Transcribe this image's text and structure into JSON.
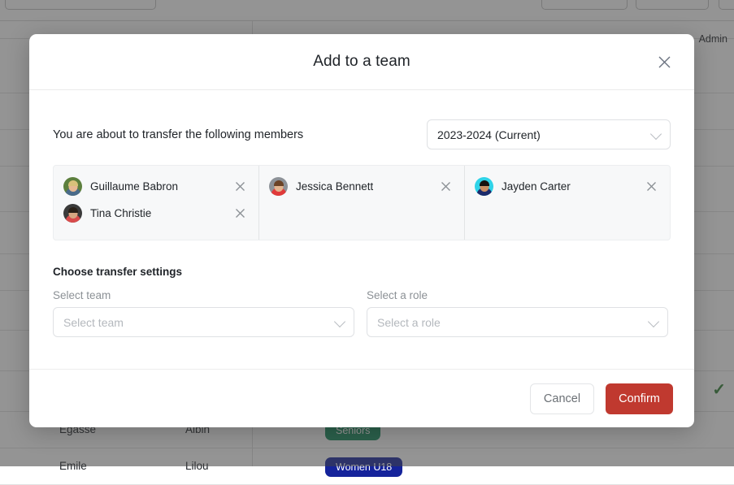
{
  "background": {
    "admin_label": "Admin",
    "check_icon": "check-icon",
    "rows": [
      {
        "last": "Egasse",
        "first": "Albin",
        "badge": "Seniors",
        "badge_color": "#12895a"
      },
      {
        "last": "Emile",
        "first": "Lilou",
        "badge": "Women U18",
        "badge_color": "#15239b"
      }
    ]
  },
  "modal": {
    "title": "Add to a team",
    "close_icon": "close-icon",
    "transfer_label": "You are about to transfer the following members",
    "year_select": {
      "value": "2023-2024 (Current)",
      "chevron_icon": "chevron-down-icon"
    },
    "members": [
      {
        "name": "Guillaume Babron",
        "remove_icon": "close-icon",
        "avatar": {
          "bg": "#5c7f3d",
          "skin": "#e6b892",
          "hair": "#d8c17a",
          "shirt": "#4a6b8a"
        }
      },
      {
        "name": "Tina Christie",
        "remove_icon": "close-icon",
        "avatar": {
          "bg": "#3a3a3a",
          "skin": "#d8a782",
          "hair": "#2b2118",
          "shirt": "#d94b4b"
        }
      },
      {
        "name": "Jessica Bennett",
        "remove_icon": "close-icon",
        "avatar": {
          "bg": "#8d9298",
          "skin": "#e3b48e",
          "hair": "#6b4326",
          "shirt": "#e03a3a"
        }
      },
      {
        "name": "Jayden Carter",
        "remove_icon": "close-icon",
        "avatar": {
          "bg": "#2fd3e8",
          "skin": "#c98f63",
          "hair": "#14120f",
          "shirt": "#1b2a6b"
        }
      }
    ],
    "settings": {
      "heading": "Choose transfer settings",
      "team": {
        "label": "Select team",
        "placeholder": "Select team",
        "value": "",
        "chevron_icon": "chevron-down-icon"
      },
      "role": {
        "label": "Select a role",
        "placeholder": "Select a role",
        "value": "",
        "chevron_icon": "chevron-down-icon"
      }
    },
    "footer": {
      "cancel_label": "Cancel",
      "confirm_label": "Confirm",
      "confirm_color": "#c0392f"
    }
  }
}
